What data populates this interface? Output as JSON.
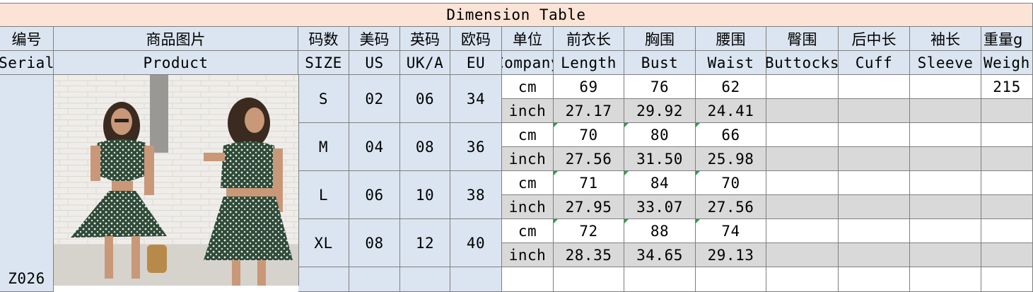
{
  "title": "Dimension Table",
  "header_cn": {
    "serial": "编号",
    "product": "商品图片",
    "size": "码数",
    "us": "美码",
    "uk": "英码",
    "eu": "欧码",
    "unit": "单位",
    "length": "前衣长",
    "bust": "胸围",
    "waist": "腰围",
    "buttocks": "臀围",
    "cuff": "后中长",
    "sleeve": "袖长",
    "weight": "重量g"
  },
  "header_en": {
    "serial": "Serial",
    "product": "Product",
    "size": "SIZE",
    "us": "US",
    "uk": "UK/A",
    "eu": "EU",
    "unit": "Company",
    "length": "Length",
    "bust": "Bust",
    "waist": "Waist",
    "buttocks": "Buttocks",
    "cuff": "Cuff",
    "sleeve": "Sleeve",
    "weight": "Weigh"
  },
  "serial_value": "Z026",
  "image_icon": "product-photo-dress",
  "colors": {
    "title_bg": "#fbe3d6",
    "header_bg": "#dbe5f1",
    "inch_row_bg": "#d9d9d9",
    "dress": "#2f4a3a"
  },
  "rows": [
    {
      "size": "S",
      "us": "02",
      "uk": "06",
      "eu": "34",
      "cm": {
        "unit": "cm",
        "length": "69",
        "bust": "76",
        "waist": "62",
        "weight": "215"
      },
      "inch": {
        "unit": "inch",
        "length": "27.17",
        "bust": "29.92",
        "waist": "24.41"
      }
    },
    {
      "size": "M",
      "us": "04",
      "uk": "08",
      "eu": "36",
      "cm": {
        "unit": "cm",
        "length": "70",
        "bust": "80",
        "waist": "66"
      },
      "inch": {
        "unit": "inch",
        "length": "27.56",
        "bust": "31.50",
        "waist": "25.98"
      }
    },
    {
      "size": "L",
      "us": "06",
      "uk": "10",
      "eu": "38",
      "cm": {
        "unit": "cm",
        "length": "71",
        "bust": "84",
        "waist": "70"
      },
      "inch": {
        "unit": "inch",
        "length": "27.95",
        "bust": "33.07",
        "waist": "27.56"
      }
    },
    {
      "size": "XL",
      "us": "08",
      "uk": "12",
      "eu": "40",
      "cm": {
        "unit": "cm",
        "length": "72",
        "bust": "88",
        "waist": "74"
      },
      "inch": {
        "unit": "inch",
        "length": "28.35",
        "bust": "34.65",
        "waist": "29.13"
      }
    }
  ]
}
